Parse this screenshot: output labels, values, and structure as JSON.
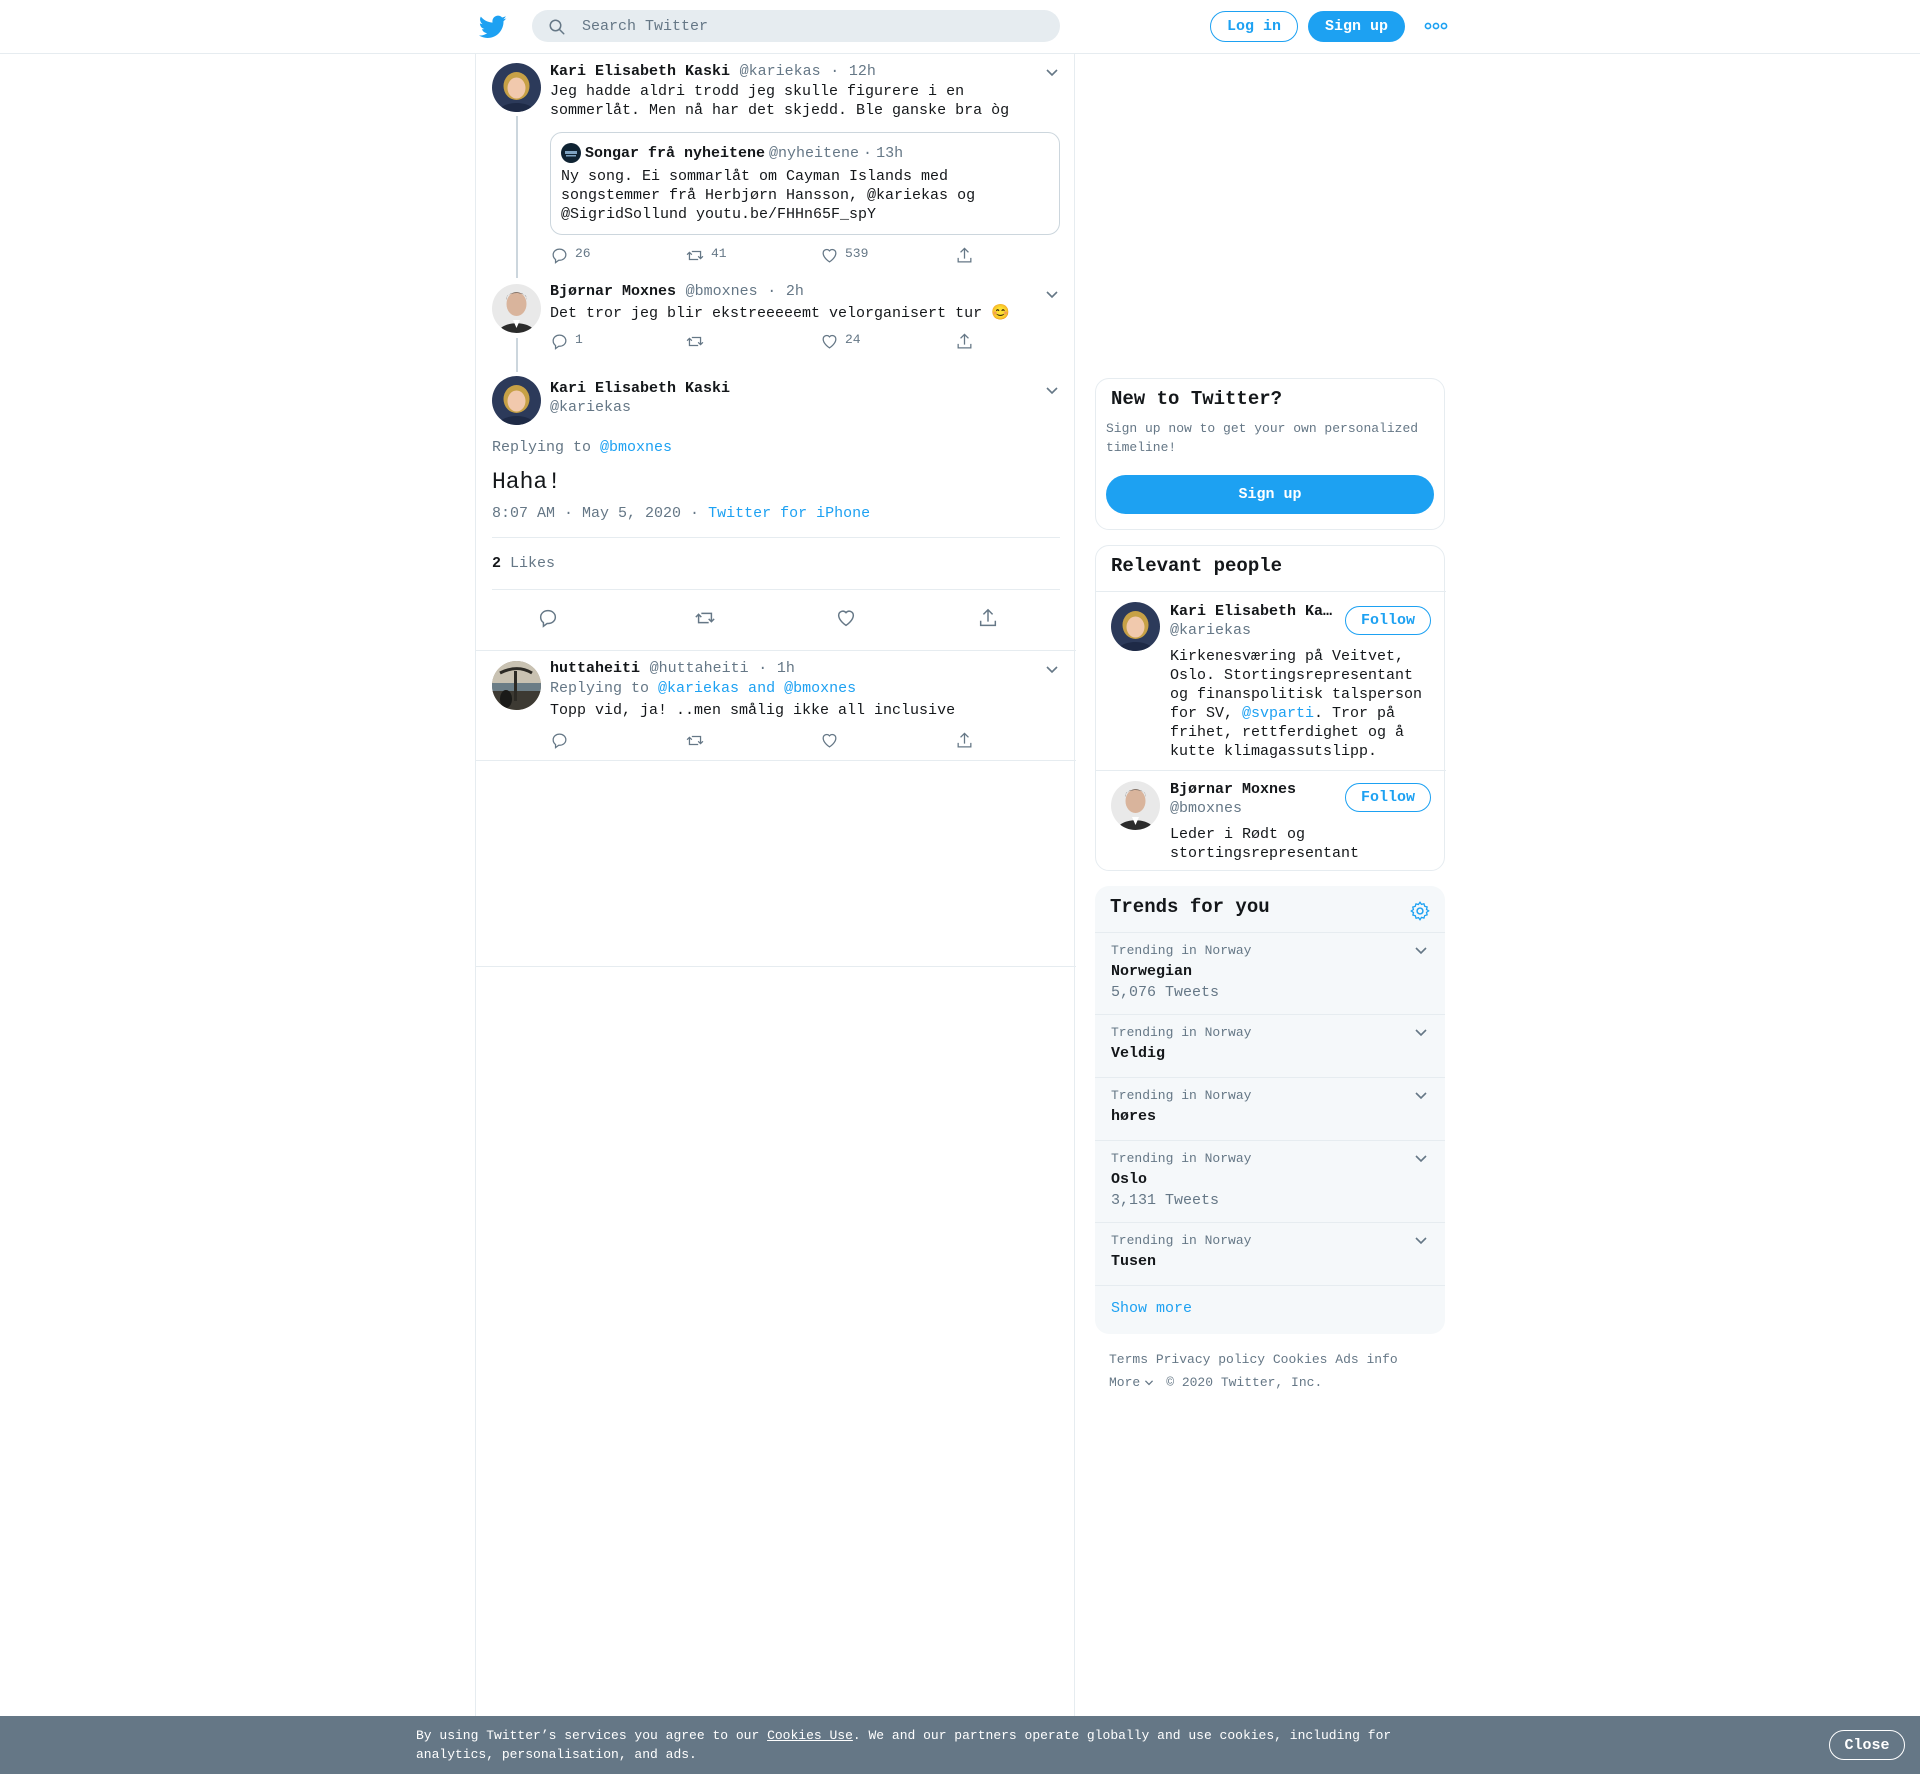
{
  "header": {
    "search_placeholder": "Search Twitter",
    "login_label": "Log in",
    "signup_label": "Sign up"
  },
  "thread": {
    "tweet1": {
      "name": "Kari Elisabeth Kaski",
      "handle": "@kariekas",
      "time": "12h",
      "text_line1": "Jeg hadde aldri trodd jeg skulle figurere i en",
      "text_line2": "sommerlåt. Men nå har det skjedd. Ble ganske bra òg",
      "quote": {
        "name": "Songar frå nyheitene",
        "handle": "@nyheitene",
        "time": "13h",
        "line1": "Ny song. Ei sommarlåt om Cayman Islands med",
        "line2": "songstemmer frå Herbjørn Hansson, @kariekas og",
        "line3": "@SigridSollund youtu.be/FHHn65F_spY"
      },
      "replies": "26",
      "retweets": "41",
      "likes": "539"
    },
    "tweet2": {
      "name": "Bjørnar Moxnes",
      "handle": "@bmoxnes",
      "time": "2h",
      "text": "Det tror jeg blir ekstreeeeemt velorganisert tur 😊",
      "replies": "1",
      "likes": "24"
    },
    "main_tweet": {
      "name": "Kari Elisabeth Kaski",
      "handle": "@kariekas",
      "replying_prefix": "Replying to",
      "replying_to": "@bmoxnes",
      "text": "Haha!",
      "timestamp": "8:07 AM · May 5, 2020",
      "source": "Twitter for iPhone",
      "likes_count": "2",
      "likes_label": "Likes"
    },
    "reply": {
      "name": "huttaheiti",
      "handle": "@huttaheiti",
      "time": "1h",
      "replying_prefix": "Replying to",
      "replying_to": "@kariekas and @bmoxnes",
      "text": "Topp vid, ja! ..men smålig ikke all inclusive"
    }
  },
  "sidebar": {
    "new_to_twitter": {
      "title": "New to Twitter?",
      "desc_line1": "Sign up now to get your own personalized",
      "desc_line2": "timeline!",
      "button": "Sign up"
    },
    "relevant_people": {
      "title": "Relevant people",
      "follow_label": "Follow",
      "people": [
        {
          "name": "Kari Elisabeth Ka…",
          "handle": "@kariekas",
          "bio_line1": "Kirkenesværing på Veitvet,",
          "bio_line2": "Oslo. Stortingsrepresentant",
          "bio_line3": "og finanspolitisk talsperson",
          "bio_line4a": "for SV, ",
          "bio_link": "@svparti",
          "bio_line4b": ". Tror på",
          "bio_line5": "frihet, rettferdighet og å",
          "bio_line6": "kutte klimagassutslipp."
        },
        {
          "name": "Bjørnar Moxnes",
          "handle": "@bmoxnes",
          "bio_line1": "Leder i Rødt og",
          "bio_line2": "stortingsrepresentant"
        }
      ]
    },
    "trends": {
      "title": "Trends for you",
      "items": [
        {
          "meta": "Trending in Norway",
          "name": "Norwegian",
          "count": "5,076 Tweets"
        },
        {
          "meta": "Trending in Norway",
          "name": "Veldig",
          "count": ""
        },
        {
          "meta": "Trending in Norway",
          "name": "høres",
          "count": ""
        },
        {
          "meta": "Trending in Norway",
          "name": "Oslo",
          "count": "3,131 Tweets"
        },
        {
          "meta": "Trending in Norway",
          "name": "Tusen",
          "count": ""
        }
      ],
      "show_more": "Show more"
    },
    "footer": {
      "terms": "Terms",
      "privacy": "Privacy policy",
      "cookies": "Cookies",
      "ads": "Ads info",
      "more": "More",
      "copyright": "© 2020 Twitter, Inc."
    }
  },
  "cookie_banner": {
    "text_before": "By using Twitter’s services you agree to our ",
    "link": "Cookies Use",
    "text_after": ". We and our partners operate globally and use cookies, including for",
    "text_line2": "analytics, personalisation, and ads.",
    "close_label": "Close"
  },
  "colors": {
    "accent": "#1da1f2",
    "text": "#14171a",
    "secondary": "#657786",
    "border": "#e6ecf0"
  }
}
